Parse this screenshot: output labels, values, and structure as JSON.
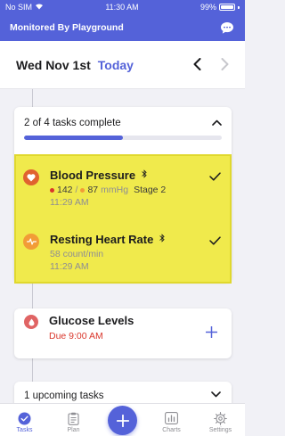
{
  "status_bar": {
    "carrier": "No SIM",
    "time": "11:30 AM",
    "battery": "99%",
    "battery_level": 0.99
  },
  "header": {
    "title": "Monitored By Playground",
    "chat_icon": "chat-bubble-icon"
  },
  "date_bar": {
    "date": "Wed Nov 1st",
    "today_label": "Today",
    "prev_icon": "chevron-left-icon",
    "next_icon": "chevron-right-icon"
  },
  "progress": {
    "text": "2 of 4 tasks complete",
    "completed": 2,
    "total": 4,
    "fraction": 0.5
  },
  "tasks": [
    {
      "title": "Blood Pressure",
      "icon": "heart-icon",
      "icon_color": "#e0622f",
      "systolic": "142",
      "separator": "/",
      "diastolic": "87",
      "unit": "mmHg",
      "stage": "Stage 2",
      "time": "11:29 AM",
      "systolic_color": "#d9362b",
      "diastolic_color": "#f29c37"
    },
    {
      "title": "Resting Heart Rate",
      "icon": "heart-pulse-icon",
      "icon_color": "#f29c37",
      "value": "58 count/min",
      "time": "11:29 AM"
    }
  ],
  "glucose": {
    "title": "Glucose Levels",
    "due": "Due 9:00 AM",
    "icon": "drop-icon",
    "icon_color": "#e06464"
  },
  "upcoming": {
    "text": "1 upcoming tasks"
  },
  "tabs": [
    {
      "label": "Tasks",
      "icon": "check-circle-icon",
      "active": true
    },
    {
      "label": "Plan",
      "icon": "clipboard-icon",
      "active": false
    },
    {
      "label": "Charts",
      "icon": "bar-chart-icon",
      "active": false
    },
    {
      "label": "Settings",
      "icon": "gear-icon",
      "active": false
    }
  ],
  "colors": {
    "accent": "#5462d9",
    "highlight": "#f0ea4c",
    "alert": "#d9362b"
  }
}
